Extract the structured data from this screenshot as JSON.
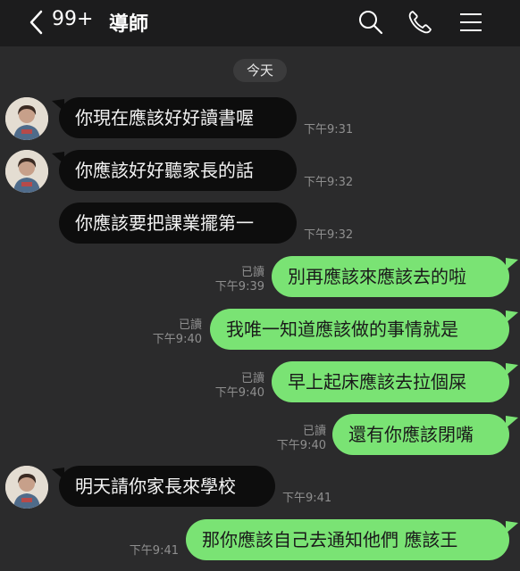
{
  "header": {
    "unread_count": "99+",
    "title": "導師"
  },
  "date_divider": "今天",
  "messages": [
    {
      "text": "你現在應該好好讀書喔",
      "time": "下午9:31"
    },
    {
      "text": "你應該好好聽家長的話",
      "time": "下午9:32"
    },
    {
      "text": "你應該要把課業擺第一",
      "time": "下午9:32"
    },
    {
      "text": "別再應該來應該去的啦",
      "status": "已讀",
      "time": "下午9:39"
    },
    {
      "text": "我唯一知道應該做的事情就是",
      "status": "已讀",
      "time": "下午9:40"
    },
    {
      "text": "早上起床應該去拉個屎",
      "status": "已讀",
      "time": "下午9:40"
    },
    {
      "text": "還有你應該閉嘴",
      "status": "已讀",
      "time": "下午9:40"
    },
    {
      "text": "明天請你家長來學校",
      "time": "下午9:41"
    },
    {
      "text": "那你應該自己去通知他們 應該王",
      "time": "下午9:41"
    }
  ],
  "colors": {
    "background": "#2b2b2c",
    "header": "#1c1c1d",
    "incoming_bubble": "#0d0d0d",
    "outgoing_bubble": "#7ae374"
  },
  "icons": [
    "back-chevron",
    "search",
    "phone",
    "menu",
    "avatar"
  ]
}
